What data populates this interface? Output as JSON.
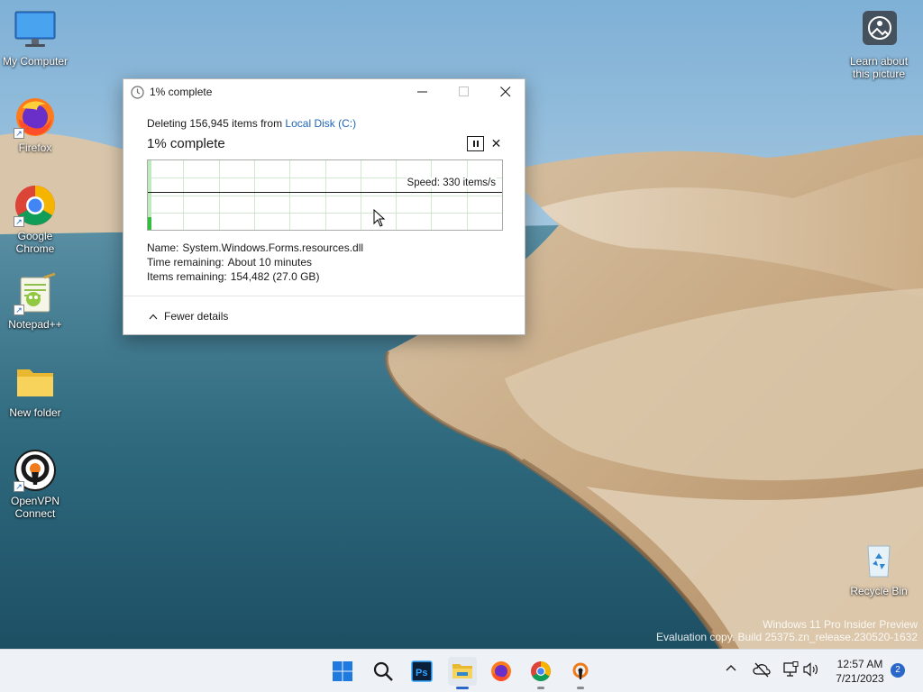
{
  "desktop": {
    "icons": [
      {
        "label": "My Computer",
        "icon": "monitor-icon"
      },
      {
        "label": "Firefox",
        "icon": "firefox-icon"
      },
      {
        "label": "Google Chrome",
        "icon": "chrome-icon"
      },
      {
        "label": "Notepad++",
        "icon": "notepadpp-icon"
      },
      {
        "label": "New folder",
        "icon": "folder-icon"
      },
      {
        "label": "OpenVPN Connect",
        "icon": "openvpn-icon"
      },
      {
        "label": "Learn about this picture",
        "icon": "camera-icon"
      },
      {
        "label": "Recycle Bin",
        "icon": "recycle-bin-icon"
      }
    ]
  },
  "dialog": {
    "title": "1% complete",
    "deleting_prefix": "Deleting 156,945 items from ",
    "deleting_location": "Local Disk (C:)",
    "headline": "1% complete",
    "progress_fraction": 0.01,
    "speed": "Speed: 330 items/s",
    "details": {
      "name_label": "Name:",
      "name_value": "System.Windows.Forms.resources.dll",
      "time_label": "Time remaining:",
      "time_value": "About 10 minutes",
      "items_label": "Items remaining:",
      "items_value": "154,482 (27.0 GB)"
    },
    "fewer_details": "Fewer details",
    "colors": {
      "progress_fill": "#2fbf3a",
      "grid": "#cfe8cf",
      "link": "#1f64b8"
    }
  },
  "watermark": {
    "line1": "Windows 11 Pro Insider Preview",
    "line2": "Evaluation copy. Build 25375.zn_release.230520-1632"
  },
  "taskbar": {
    "apps": [
      "start-icon",
      "search-icon",
      "photoshop-icon",
      "file-explorer-icon",
      "firefox-icon",
      "chrome-icon",
      "openvpn-icon"
    ],
    "photoshop_label": "Ps",
    "time": "12:57 AM",
    "date": "7/21/2023",
    "notification_count": "2",
    "accent": "#2b66c9"
  }
}
